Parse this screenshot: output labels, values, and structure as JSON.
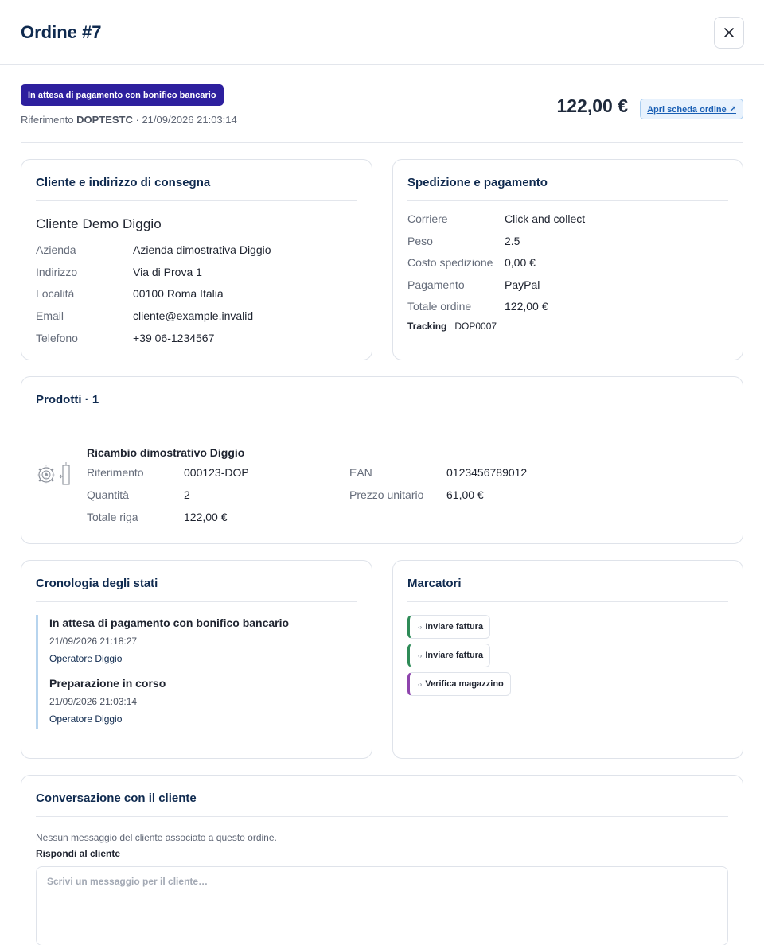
{
  "header": {
    "title": "Ordine #7",
    "close_icon": "close-icon"
  },
  "summary": {
    "status": "In attesa di pagamento con bonifico bancario",
    "status_color": "#2d1f9e",
    "reference_label": "Riferimento",
    "reference_code": "DOPTESTC",
    "reference_datetime": "· 21/09/2026 21:03:14",
    "total": "122,00 €",
    "open_order_label": "Apri scheda ordine ↗"
  },
  "customer": {
    "title": "Cliente e indirizzo di consegna",
    "name": "Cliente Demo Diggio",
    "rows": [
      {
        "label": "Azienda",
        "value": "Azienda dimostrativa Diggio"
      },
      {
        "label": "Indirizzo",
        "value": "Via di Prova 1"
      },
      {
        "label": "Località",
        "value": "00100 Roma Italia"
      },
      {
        "label": "Email",
        "value": "cliente@example.invalid"
      },
      {
        "label": "Telefono",
        "value": "+39 06-1234567"
      }
    ]
  },
  "shipping": {
    "title": "Spedizione e pagamento",
    "rows": [
      {
        "label": "Corriere",
        "value": "Click and collect"
      },
      {
        "label": "Peso",
        "value": "2.5"
      },
      {
        "label": "Costo spedizione",
        "value": "0,00 €"
      },
      {
        "label": "Pagamento",
        "value": "PayPal"
      },
      {
        "label": "Totale ordine",
        "value": "122,00 €"
      }
    ],
    "tracking_label": "Tracking",
    "tracking_value": "DOP0007"
  },
  "products": {
    "title": "Prodotti · 1",
    "items": [
      {
        "name": "Ricambio dimostrativo Diggio",
        "reference_label": "Riferimento",
        "reference": "000123-DOP",
        "ean_label": "EAN",
        "ean": "0123456789012",
        "quantity_label": "Quantità",
        "quantity": "2",
        "unit_price_label": "Prezzo unitario",
        "unit_price": "61,00 €",
        "line_total_label": "Totale riga",
        "line_total": "122,00 €"
      }
    ]
  },
  "history": {
    "title": "Cronologia degli stati",
    "items": [
      {
        "status": "In attesa di pagamento con bonifico bancario",
        "datetime": "21/09/2026 21:18:27",
        "user": "Operatore Diggio"
      },
      {
        "status": "Preparazione in corso",
        "datetime": "21/09/2026 21:03:14",
        "user": "Operatore Diggio"
      }
    ]
  },
  "markers": {
    "title": "Marcatori",
    "items": [
      {
        "label": "Inviare fattura",
        "color": "#2e8b57"
      },
      {
        "label": "Inviare fattura",
        "color": "#2e8b57"
      },
      {
        "label": "Verifica magazzino",
        "color": "#8e44ad"
      }
    ]
  },
  "conversation": {
    "title": "Conversazione con il cliente",
    "empty_text": "Nessun messaggio del cliente associato a questo ordine.",
    "reply_label": "Rispondi al cliente",
    "reply_placeholder": "Scrivi un messaggio per il cliente…"
  }
}
